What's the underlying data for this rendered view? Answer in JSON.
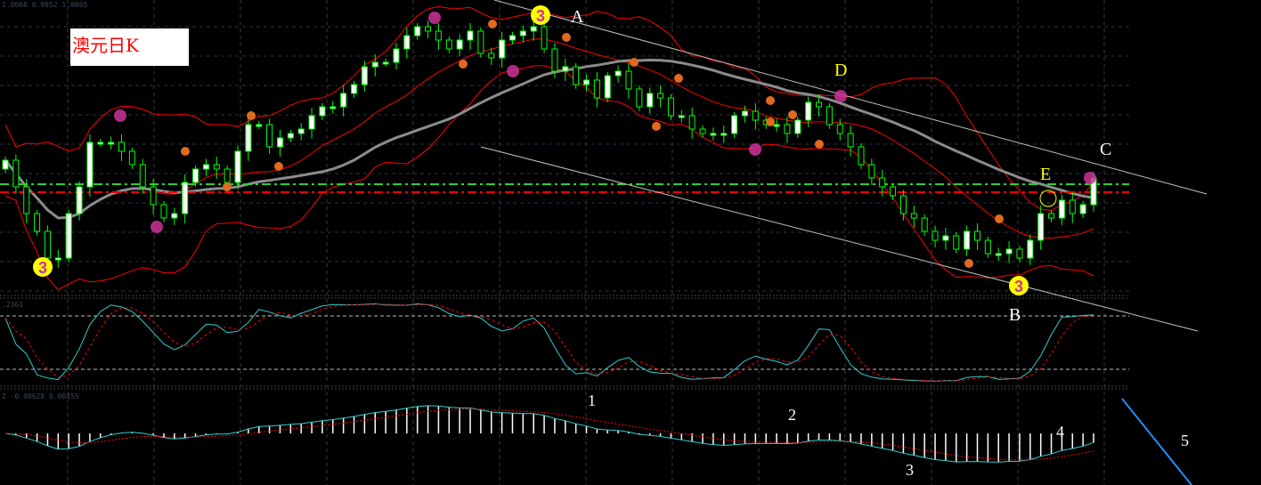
{
  "header": {
    "main_values": "1.0068 0.9952 1.0065",
    "stoch_values": ".2361",
    "macd_values": "2 -0.00628 0.00455"
  },
  "title_label": "澳元日K",
  "annotations": {
    "A": "A",
    "B": "B",
    "C": "C",
    "D": "D",
    "E": "E",
    "n1": "1",
    "n2": "2",
    "n3": "3",
    "n4": "4",
    "n5": "5",
    "wave3": "3"
  },
  "colors": {
    "background": "#000000",
    "bull_body": "#ffffff",
    "bear_body": "#000000",
    "candle_outline": "#00ff00",
    "bollinger": "#ff0000",
    "moving_average": "#8c8c8c",
    "stoch_main": "#33cccc",
    "stoch_signal": "#ff0000",
    "macd_hist": "#ffffff",
    "support_green": "#33cc33",
    "support_red": "#ff0000",
    "trendline": "#c0c0c0",
    "marker_magenta": "#cc3399",
    "marker_orange": "#e06a20",
    "wave_marker": "#ffff00"
  },
  "chart_data": {
    "type": "candlestick",
    "title": "澳元日K",
    "ylim": [
      0.994,
      1.06
    ],
    "open_first": 1.022,
    "closes": [
      1.024,
      1.018,
      1.012,
      1.008,
      1.002,
      1.002,
      1.012,
      1.018,
      1.028,
      1.028,
      1.028,
      1.026,
      1.023,
      1.018,
      1.014,
      1.011,
      1.012,
      1.019,
      1.022,
      1.023,
      1.022,
      1.019,
      1.026,
      1.032,
      1.032,
      1.027,
      1.029,
      1.03,
      1.031,
      1.034,
      1.036,
      1.036,
      1.039,
      1.041,
      1.045,
      1.046,
      1.046,
      1.049,
      1.052,
      1.054,
      1.053,
      1.051,
      1.049,
      1.051,
      1.053,
      1.048,
      1.047,
      1.051,
      1.052,
      1.053,
      1.054,
      1.049,
      1.044,
      1.045,
      1.041,
      1.042,
      1.038,
      1.043,
      1.044,
      1.04,
      1.036,
      1.039,
      1.038,
      1.034,
      1.034,
      1.031,
      1.03,
      1.03,
      1.03,
      1.034,
      1.035,
      1.033,
      1.032,
      1.032,
      1.03,
      1.033,
      1.037,
      1.036,
      1.032,
      1.03,
      1.027,
      1.023,
      1.02,
      1.018,
      1.016,
      1.012,
      1.011,
      1.008,
      1.006,
      1.007,
      1.004,
      1.008,
      1.006,
      1.003,
      1.003,
      1.004,
      1.002,
      1.006,
      1.012,
      1.011,
      1.015,
      1.012,
      1.014,
      1.02
    ],
    "support_levels": [
      1.0186,
      1.0168
    ],
    "indicators": [
      "Bollinger Bands",
      "Moving Average",
      "Stochastic",
      "MACD"
    ],
    "stochastic_levels": [
      80,
      20
    ]
  }
}
